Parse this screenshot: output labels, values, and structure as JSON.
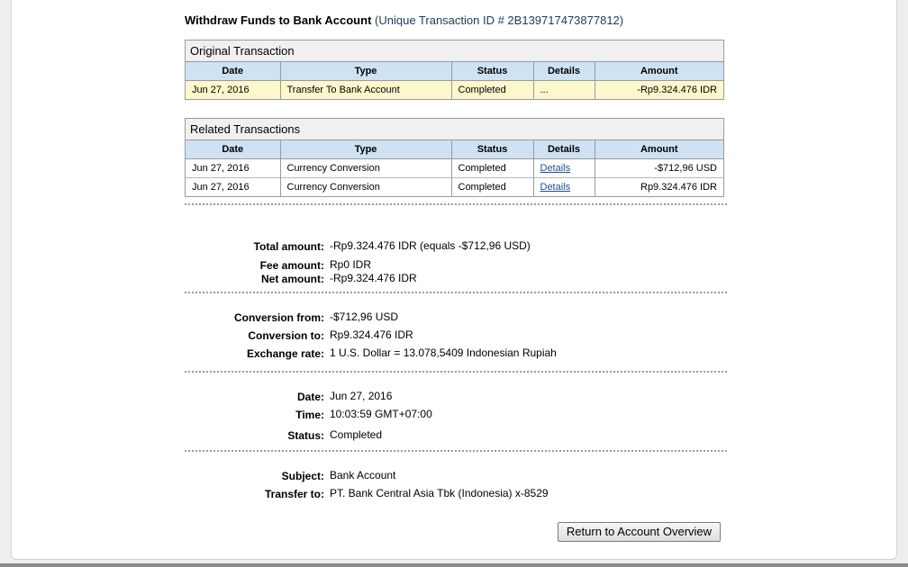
{
  "page": {
    "heading_bold": "Withdraw Funds to Bank Account",
    "heading_id": "(Unique Transaction ID # 2B139717473877812)"
  },
  "original": {
    "title": "Original Transaction",
    "headers": [
      "Date",
      "Type",
      "Status",
      "Details",
      "Amount"
    ],
    "row": {
      "date": "Jun 27, 2016",
      "type": "Transfer To Bank Account",
      "status": "Completed",
      "details": "...",
      "amount": "-Rp9.324.476 IDR"
    }
  },
  "related": {
    "title": "Related Transactions",
    "headers": [
      "Date",
      "Type",
      "Status",
      "Details",
      "Amount"
    ],
    "rows": [
      {
        "date": "Jun 27, 2016",
        "type": "Currency Conversion",
        "status": "Completed",
        "details": "Details",
        "amount": "-$712,96 USD"
      },
      {
        "date": "Jun 27, 2016",
        "type": "Currency Conversion",
        "status": "Completed",
        "details": "Details",
        "amount": "Rp9.324.476 IDR"
      }
    ]
  },
  "summary": {
    "total_label": "Total amount:",
    "total_value": "-Rp9.324.476 IDR (equals -$712,96 USD)",
    "fee_label": "Fee amount:",
    "fee_value": "Rp0 IDR",
    "net_label": "Net amount:",
    "net_value": "-Rp9.324.476 IDR"
  },
  "conversion": {
    "from_label": "Conversion from:",
    "from_value": "-$712,96 USD",
    "to_label": "Conversion to:",
    "to_value": "Rp9.324.476 IDR",
    "rate_label": "Exchange rate:",
    "rate_value": "1 U.S. Dollar = 13.078,5409 Indonesian Rupiah"
  },
  "timing": {
    "date_label": "Date:",
    "date_value": "Jun 27, 2016",
    "time_label": "Time:",
    "time_value": "10:03:59 GMT+07:00",
    "status_label": "Status:",
    "status_value": "Completed"
  },
  "destination": {
    "subject_label": "Subject:",
    "subject_value": "Bank Account",
    "transfer_label": "Transfer to:",
    "transfer_value": "PT. Bank Central Asia Tbk (Indonesia) x-8529"
  },
  "actions": {
    "return_label": "Return to Account Overview"
  },
  "colors": {
    "header_blue": "#cfe2f3",
    "highlight_yellow": "#fdf8cc",
    "link_blue": "#1d4f91"
  }
}
